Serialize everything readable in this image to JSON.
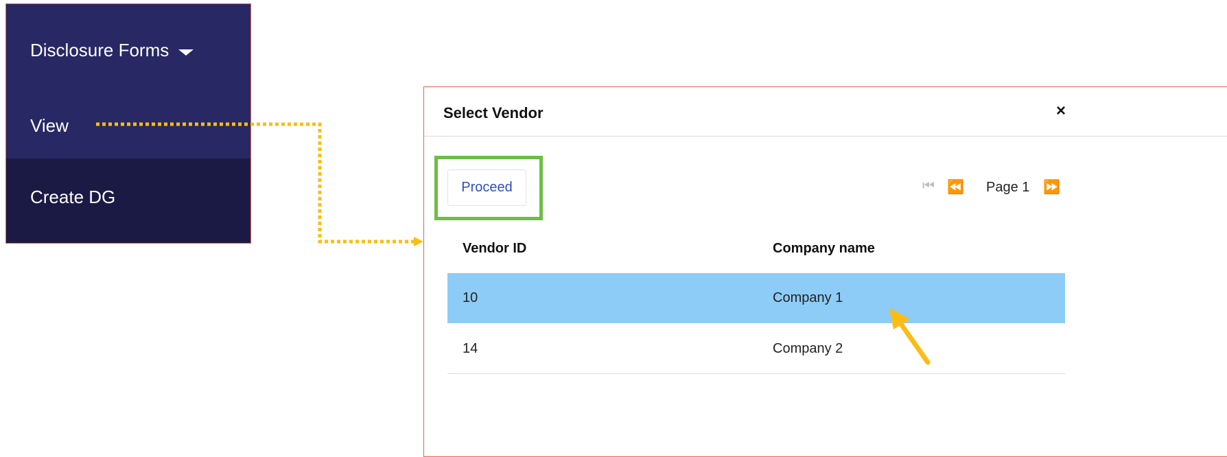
{
  "menu": {
    "header_label": "Disclosure Forms",
    "items": [
      {
        "label": "View"
      },
      {
        "label": "Create DG"
      }
    ]
  },
  "dialog": {
    "title": "Select Vendor",
    "close_label": "×",
    "proceed_label": "Proceed",
    "pagination": {
      "first_glyph": "⏮",
      "prev_glyph": "⏪",
      "page_label": "Page 1",
      "next_glyph": "⏩"
    },
    "table": {
      "columns": [
        "Vendor ID",
        "Company name"
      ],
      "rows": [
        {
          "vendor_id": "10",
          "company": "Company 1",
          "selected": true
        },
        {
          "vendor_id": "14",
          "company": "Company 2",
          "selected": false
        }
      ]
    }
  },
  "colors": {
    "menu_bg": "#272864",
    "menu_active_bg": "#1b1a45",
    "selected_row": "#8dccf6",
    "highlight_border": "#6cbe45",
    "annotation": "#fbbd14",
    "link_blue": "#2f4fbf"
  },
  "icons": [
    "caret-down-icon",
    "close-icon",
    "first-page-icon",
    "prev-page-icon",
    "next-page-icon",
    "annotation-arrow-icon"
  ]
}
